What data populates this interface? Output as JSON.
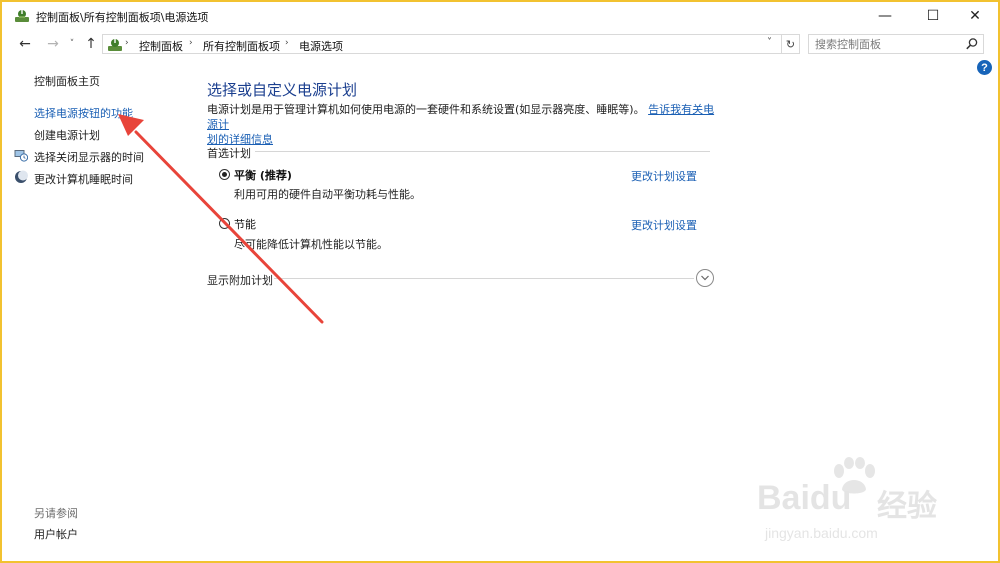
{
  "window": {
    "title": "控制面板\\所有控制面板项\\电源选项",
    "minimize": "—",
    "maximize": "☐",
    "close": "✕"
  },
  "nav": {
    "back": "←",
    "forward": "→",
    "recent": "˅",
    "up": "↑",
    "breadcrumbs": [
      "控制面板",
      "所有控制面板项",
      "电源选项"
    ],
    "separator": "›",
    "dropdown": "˅",
    "refresh": "↻",
    "search_placeholder": "搜索控制面板"
  },
  "help": {
    "label": "?"
  },
  "sidebar": {
    "home": "控制面板主页",
    "items": [
      {
        "label": "选择电源按钮的功能",
        "icon": null
      },
      {
        "label": "创建电源计划",
        "icon": null
      },
      {
        "label": "选择关闭显示器的时间",
        "icon": "monitor-clock-icon"
      },
      {
        "label": "更改计算机睡眠时间",
        "icon": "moon-icon"
      }
    ],
    "see_also_title": "另请参阅",
    "see_also_items": [
      "用户帐户"
    ]
  },
  "main": {
    "title": "选择或自定义电源计划",
    "description": "电源计划是用于管理计算机如何使用电源的一套硬件和系统设置(如显示器亮度、睡眠等)。",
    "description_link_1": "告诉我有关电源计",
    "description_link_2": "划的详细信息",
    "preferred_section": "首选计划",
    "plans": [
      {
        "name": "平衡 (推荐)",
        "description": "利用可用的硬件自动平衡功耗与性能。",
        "link": "更改计划设置",
        "selected": true
      },
      {
        "name": "节能",
        "description": "尽可能降低计算机性能以节能。",
        "link": "更改计划设置",
        "selected": false
      }
    ],
    "additional_section": "显示附加计划"
  },
  "watermark": {
    "brand": "Baidu",
    "brand_cn": "经验",
    "url": "jingyan.baidu.com"
  },
  "colors": {
    "frame_border": "#f2c230",
    "link_blue": "#1a5fb4",
    "title_blue": "#1b3f8f",
    "annotation_arrow": "#e8443a"
  }
}
